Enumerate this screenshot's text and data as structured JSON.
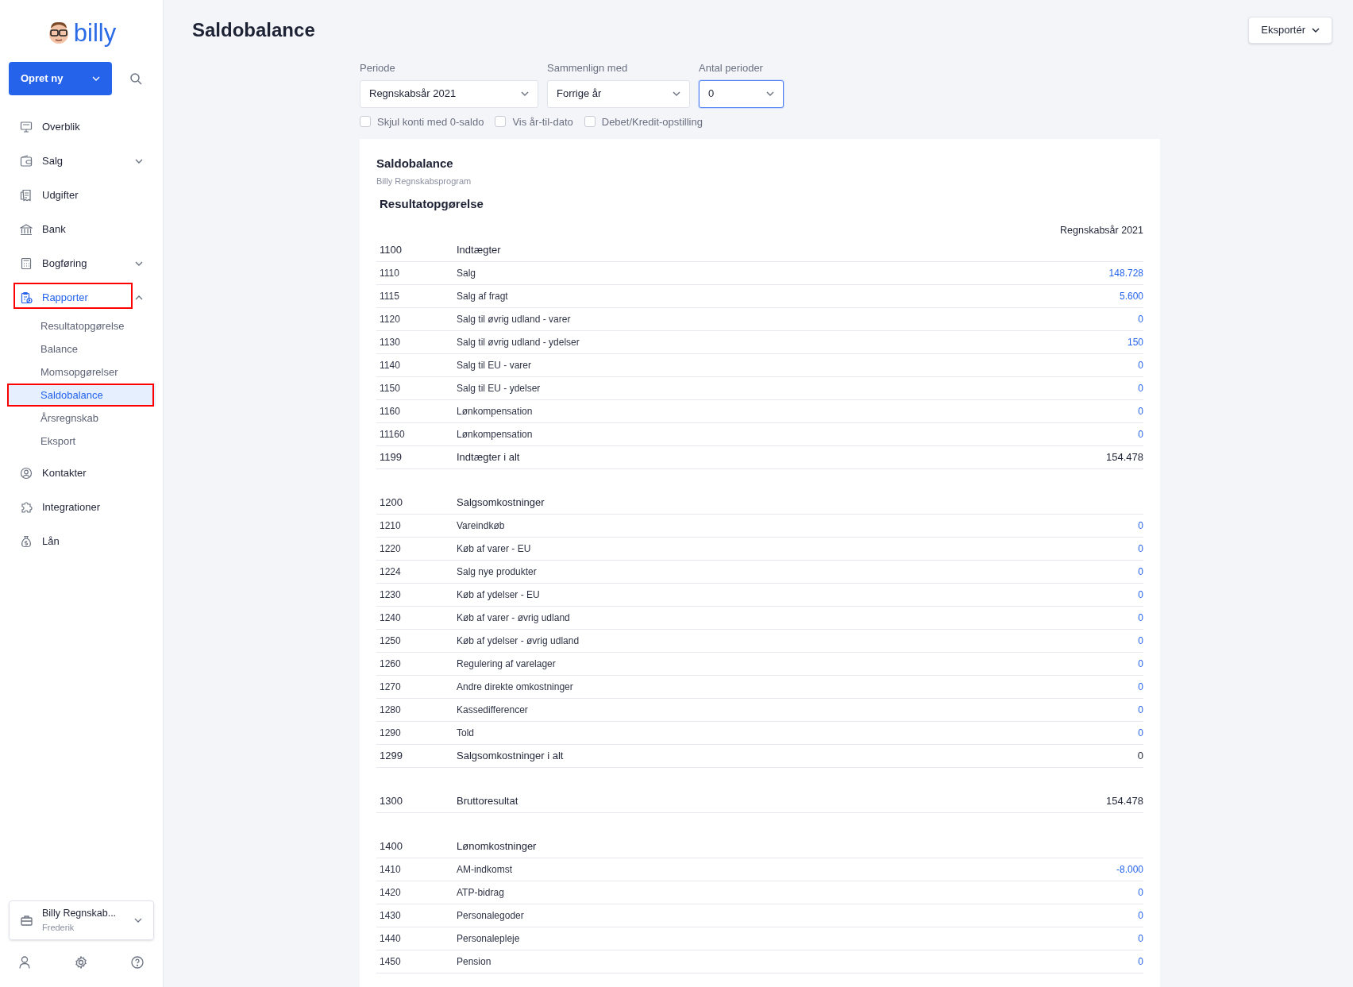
{
  "logo": {
    "text": "billy"
  },
  "create_button": {
    "label": "Opret ny"
  },
  "nav": [
    {
      "label": "Overblik",
      "selected": false
    },
    {
      "label": "Salg",
      "selected": false,
      "expanded": false
    },
    {
      "label": "Udgifter",
      "selected": false
    },
    {
      "label": "Bank",
      "selected": false
    },
    {
      "label": "Bogføring",
      "selected": false,
      "expanded": false
    },
    {
      "label": "Rapporter",
      "selected": true,
      "highlighted": true,
      "expanded": true,
      "children": [
        {
          "label": "Resultatopgørelse",
          "selected": false,
          "highlighted": false
        },
        {
          "label": "Balance",
          "selected": false,
          "highlighted": false
        },
        {
          "label": "Momsopgørelser",
          "selected": false,
          "highlighted": false
        },
        {
          "label": "Saldobalance",
          "selected": true,
          "highlighted": true
        },
        {
          "label": "Årsregnskab",
          "selected": false,
          "highlighted": false
        },
        {
          "label": "Eksport",
          "selected": false,
          "highlighted": false
        }
      ]
    },
    {
      "label": "Kontakter",
      "selected": false
    },
    {
      "label": "Integrationer",
      "selected": false
    },
    {
      "label": "Lån",
      "selected": false
    }
  ],
  "organization": {
    "name": "Billy Regnskab...",
    "user": "Frederik"
  },
  "page_title": "Saldobalance",
  "export_button": {
    "label": "Eksportér"
  },
  "filters": [
    {
      "label": "Periode",
      "value": "Regnskabsår 2021",
      "focused": false
    },
    {
      "label": "Sammenlign med",
      "value": "Forrige år",
      "focused": false
    },
    {
      "label": "Antal perioder",
      "value": "0",
      "focused": true
    }
  ],
  "options": [
    {
      "label": "Skjul konti med 0-saldo",
      "checked": false
    },
    {
      "label": "Vis år-til-dato",
      "checked": false
    },
    {
      "label": "Debet/Kredit-opstilling",
      "checked": false
    }
  ],
  "report": {
    "title": "Saldobalance",
    "company": "Billy Regnskabsprogram",
    "section_title": "Resultatopgørelse",
    "column_header": "Regnskabsår 2021",
    "groups": [
      {
        "rows": [
          {
            "kind": "group",
            "number": "1100",
            "name": "Indtægter"
          },
          {
            "kind": "account",
            "number": "1110",
            "name": "Salg",
            "value": "148.728"
          },
          {
            "kind": "account",
            "number": "1115",
            "name": "Salg af fragt",
            "value": "5.600"
          },
          {
            "kind": "account",
            "number": "1120",
            "name": "Salg til øvrig udland - varer",
            "value": "0"
          },
          {
            "kind": "account",
            "number": "1130",
            "name": "Salg til øvrig udland - ydelser",
            "value": "150"
          },
          {
            "kind": "account",
            "number": "1140",
            "name": "Salg til EU - varer",
            "value": "0"
          },
          {
            "kind": "account",
            "number": "1150",
            "name": "Salg til EU - ydelser",
            "value": "0"
          },
          {
            "kind": "account",
            "number": "1160",
            "name": "Lønkompensation",
            "value": "0"
          },
          {
            "kind": "account",
            "number": "11160",
            "name": "Lønkompensation",
            "value": "0"
          },
          {
            "kind": "total",
            "number": "1199",
            "name": "Indtægter i alt",
            "value": "154.478"
          }
        ]
      },
      {
        "rows": [
          {
            "kind": "group",
            "number": "1200",
            "name": "Salgsomkostninger"
          },
          {
            "kind": "account",
            "number": "1210",
            "name": "Vareindkøb",
            "value": "0"
          },
          {
            "kind": "account",
            "number": "1220",
            "name": "Køb af varer - EU",
            "value": "0"
          },
          {
            "kind": "account",
            "number": "1224",
            "name": "Salg nye produkter",
            "value": "0"
          },
          {
            "kind": "account",
            "number": "1230",
            "name": "Køb af ydelser - EU",
            "value": "0"
          },
          {
            "kind": "account",
            "number": "1240",
            "name": "Køb af varer - øvrig udland",
            "value": "0"
          },
          {
            "kind": "account",
            "number": "1250",
            "name": "Køb af ydelser - øvrig udland",
            "value": "0"
          },
          {
            "kind": "account",
            "number": "1260",
            "name": "Regulering af varelager",
            "value": "0"
          },
          {
            "kind": "account",
            "number": "1270",
            "name": "Andre direkte omkostninger",
            "value": "0"
          },
          {
            "kind": "account",
            "number": "1280",
            "name": "Kassedifferencer",
            "value": "0"
          },
          {
            "kind": "account",
            "number": "1290",
            "name": "Told",
            "value": "0"
          },
          {
            "kind": "total",
            "number": "1299",
            "name": "Salgsomkostninger i alt",
            "value": "0"
          }
        ]
      },
      {
        "rows": [
          {
            "kind": "total",
            "number": "1300",
            "name": "Bruttoresultat",
            "value": "154.478"
          }
        ]
      },
      {
        "rows": [
          {
            "kind": "group",
            "number": "1400",
            "name": "Lønomkostninger"
          },
          {
            "kind": "account",
            "number": "1410",
            "name": "AM-indkomst",
            "value": "-8.000"
          },
          {
            "kind": "account",
            "number": "1420",
            "name": "ATP-bidrag",
            "value": "0"
          },
          {
            "kind": "account",
            "number": "1430",
            "name": "Personalegoder",
            "value": "0"
          },
          {
            "kind": "account",
            "number": "1440",
            "name": "Personalepleje",
            "value": "0"
          },
          {
            "kind": "account",
            "number": "1450",
            "name": "Pension",
            "value": "0"
          }
        ]
      }
    ]
  }
}
